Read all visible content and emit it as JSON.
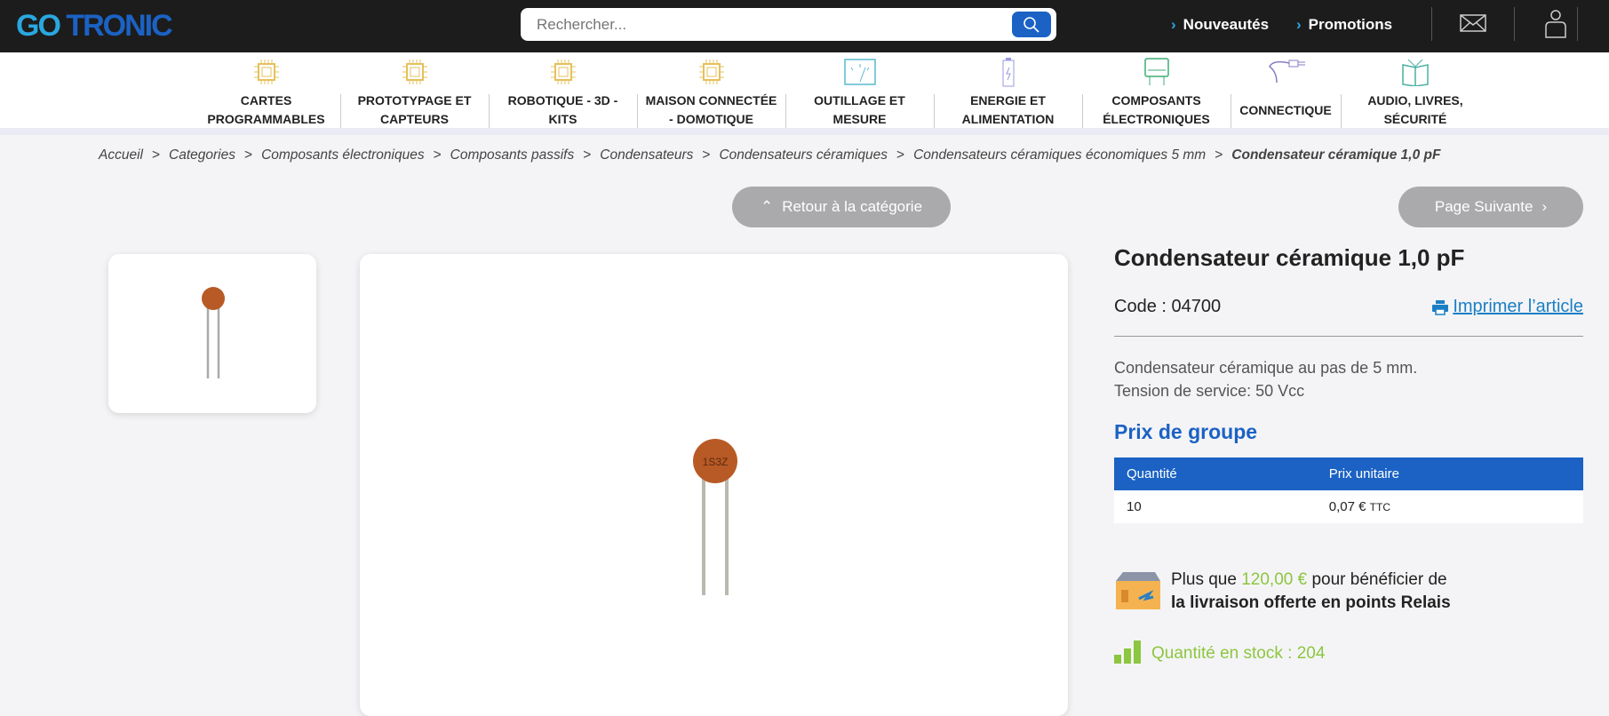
{
  "header": {
    "logo_go": "GO",
    "logo_tronic": "TRONIC",
    "search_placeholder": "Rechercher...",
    "links": [
      {
        "label": "Nouveautés"
      },
      {
        "label": "Promotions"
      }
    ]
  },
  "nav": [
    {
      "l1": "CARTES",
      "l2": "PROGRAMMABLES",
      "icon": "chip-icon"
    },
    {
      "l1": "PROTOTYPAGE ET",
      "l2": "CAPTEURS",
      "icon": "chip-icon"
    },
    {
      "l1": "ROBOTIQUE - 3D -",
      "l2": "KITS",
      "icon": "chip-icon"
    },
    {
      "l1": "MAISON CONNECTÉE",
      "l2": "- DOMOTIQUE",
      "icon": "chip-icon"
    },
    {
      "l1": "OUTILLAGE ET",
      "l2": "MESURE",
      "icon": "meter-icon"
    },
    {
      "l1": "ENERGIE ET",
      "l2": "ALIMENTATION",
      "icon": "battery-icon"
    },
    {
      "l1": "COMPOSANTS",
      "l2": "ÉLECTRONIQUES",
      "icon": "capacitor-icon"
    },
    {
      "l1": "CONNECTIQUE",
      "l2": "",
      "icon": "plug-icon"
    },
    {
      "l1": "AUDIO, LIVRES,",
      "l2": "SÉCURITÉ",
      "icon": "book-icon"
    }
  ],
  "breadcrumb": [
    "Accueil",
    "Categories",
    "Composants électroniques",
    "Composants passifs",
    "Condensateurs",
    "Condensateurs céramiques",
    "Condensateurs céramiques économiques 5 mm",
    "Condensateur céramique 1,0 pF"
  ],
  "buttons": {
    "back": "Retour à la catégorie",
    "next": "Page Suivante"
  },
  "product": {
    "title": "Condensateur céramique 1,0 pF",
    "code": "Code : 04700",
    "print": "Imprimer l’article",
    "desc1": "Condensateur céramique au pas de 5 mm.",
    "desc2": "Tension de service: 50 Vcc",
    "group_title": "Prix de groupe",
    "table": {
      "headers": [
        "Quantité",
        "Prix unitaire"
      ],
      "rows": [
        {
          "qty": "10",
          "price": "0,07 €",
          "tax": "TTC"
        }
      ]
    },
    "delivery": {
      "pre": "Plus que",
      "amount": "120,00 €",
      "post": "pour bénéficier de",
      "line2": "la livraison offerte en points Relais"
    },
    "stock": "Quantité en stock : 204"
  },
  "colors": {
    "brand": "#1b62c4",
    "accent": "#2aa7e0",
    "green": "#8dc63f"
  }
}
